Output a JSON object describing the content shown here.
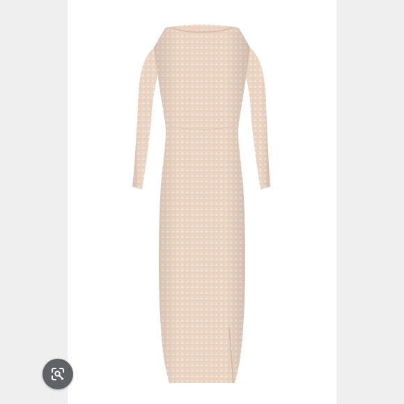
{
  "viewer": {
    "background_color": "#ffffff",
    "side_band_color": "#efefef"
  },
  "product_image": {
    "subject": "long-sleeve-sequin-maxi-dress-icon",
    "dress_color": "#ecd6c4",
    "sequin_color": "#f6ebe0"
  },
  "visual_search": {
    "icon": "lens-visual-search-icon",
    "button_color": "#5f6368"
  }
}
